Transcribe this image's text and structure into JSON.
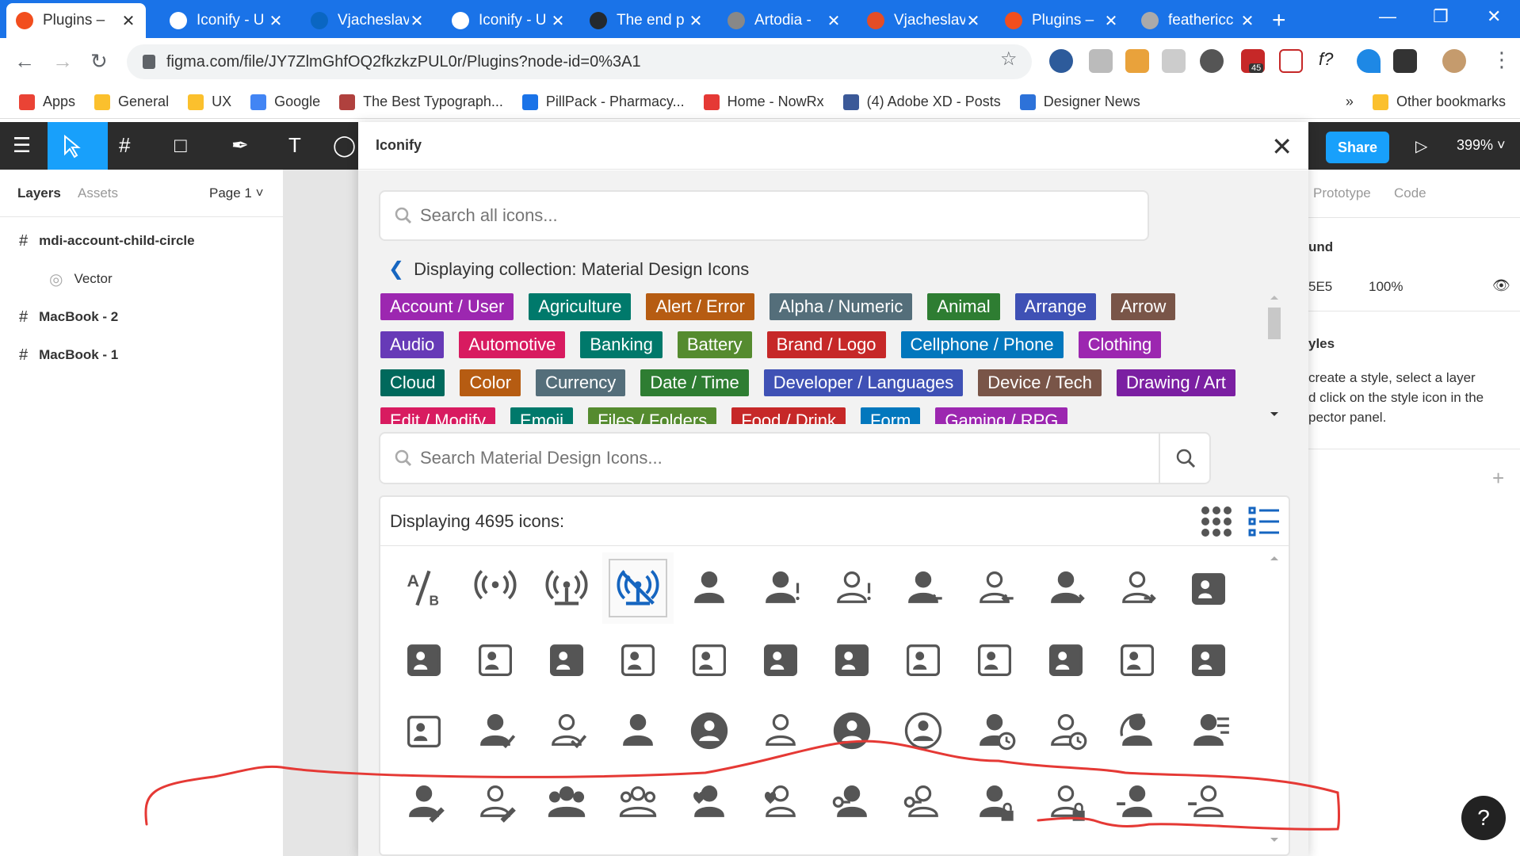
{
  "browser": {
    "tabs": [
      {
        "title": "Plugins – ",
        "active": true,
        "favicon_color": "#f24e1e"
      },
      {
        "title": "Iconify - U",
        "active": false,
        "favicon_color": "#ffffff"
      },
      {
        "title": "Vjacheslav",
        "active": false,
        "favicon_color": "#0a66c2"
      },
      {
        "title": "Iconify - U",
        "active": false,
        "favicon_color": "#ffffff"
      },
      {
        "title": "The end p",
        "active": false,
        "favicon_color": "#24292e"
      },
      {
        "title": "Artodia - ",
        "active": false,
        "favicon_color": "#888888"
      },
      {
        "title": "Vjacheslav",
        "active": false,
        "favicon_color": "#e44d26"
      },
      {
        "title": "Plugins – ",
        "active": false,
        "favicon_color": "#f24e1e"
      },
      {
        "title": "feathericc",
        "active": false,
        "favicon_color": "#aaaaaa"
      }
    ],
    "url": "figma.com/file/JY7ZlmGhfOQ2fkzkzPUL0r/Plugins?node-id=0%3A1",
    "bookmarks": [
      {
        "label": "Apps",
        "color": "#ea4335"
      },
      {
        "label": "General",
        "color": "#fbc02d"
      },
      {
        "label": "UX",
        "color": "#fbc02d"
      },
      {
        "label": "Google",
        "color": "#4285f4"
      },
      {
        "label": "The Best Typograph...",
        "color": "#b0413e"
      },
      {
        "label": "PillPack - Pharmacy...",
        "color": "#1a73e8"
      },
      {
        "label": "Home - NowRx",
        "color": "#e53935"
      },
      {
        "label": "(4) Adobe XD - Posts",
        "color": "#3b5998"
      },
      {
        "label": "Designer News",
        "color": "#2d72d9"
      }
    ],
    "bookmarks_more": "»",
    "other_bookmarks": "Other bookmarks",
    "ext_badge": "45"
  },
  "figma": {
    "share_label": "Share",
    "zoom": "399%",
    "left_tabs": {
      "layers": "Layers",
      "assets": "Assets",
      "page": "Page 1"
    },
    "layers": [
      {
        "name": "mdi-account-child-circle",
        "indent": false,
        "bold": true
      },
      {
        "name": "Vector",
        "indent": true,
        "bold": false
      },
      {
        "name": "MacBook - 2",
        "indent": false,
        "bold": true
      },
      {
        "name": "MacBook - 1",
        "indent": false,
        "bold": true
      }
    ],
    "right": {
      "tab_prototype": "Prototype",
      "tab_code": "Code",
      "bg_label": "und",
      "bg_hex": "5E5",
      "bg_opacity": "100%",
      "styles_label": "yles",
      "styles_hint": "create a style, select a layer\nd click on the style icon in the\npector panel."
    }
  },
  "plugin": {
    "title": "Iconify",
    "search_placeholder": "Search all icons...",
    "collection_text": "Displaying collection: Material Design Icons",
    "categories": [
      [
        {
          "label": "Account / User",
          "color": "#9c27b0"
        },
        {
          "label": "Agriculture",
          "color": "#00796b"
        },
        {
          "label": "Alert / Error",
          "color": "#b65c12"
        },
        {
          "label": "Alpha / Numeric",
          "color": "#546e7a"
        },
        {
          "label": "Animal",
          "color": "#2e7d32"
        },
        {
          "label": "Arrange",
          "color": "#3f51b5"
        },
        {
          "label": "Arrow",
          "color": "#795548"
        }
      ],
      [
        {
          "label": "Audio",
          "color": "#673ab7"
        },
        {
          "label": "Automotive",
          "color": "#d81b60"
        },
        {
          "label": "Banking",
          "color": "#00796b"
        },
        {
          "label": "Battery",
          "color": "#558b2f"
        },
        {
          "label": "Brand / Logo",
          "color": "#c62828"
        },
        {
          "label": "Cellphone / Phone",
          "color": "#0277bd"
        },
        {
          "label": "Clothing",
          "color": "#9c27b0"
        }
      ],
      [
        {
          "label": "Cloud",
          "color": "#00695c"
        },
        {
          "label": "Color",
          "color": "#b65c12"
        },
        {
          "label": "Currency",
          "color": "#546e7a"
        },
        {
          "label": "Date / Time",
          "color": "#2e7d32"
        },
        {
          "label": "Developer / Languages",
          "color": "#3f51b5"
        },
        {
          "label": "Device / Tech",
          "color": "#795548"
        },
        {
          "label": "Drawing / Art",
          "color": "#7b1fa2"
        }
      ],
      [
        {
          "label": "Edit / Modify",
          "color": "#d81b60"
        },
        {
          "label": "Emoji",
          "color": "#00796b"
        },
        {
          "label": "Files / Folders",
          "color": "#558b2f"
        },
        {
          "label": "Food / Drink",
          "color": "#c62828"
        },
        {
          "label": "Form",
          "color": "#0277bd"
        },
        {
          "label": "Gaming / RPG",
          "color": "#9c27b0"
        }
      ]
    ],
    "search2_placeholder": "Search Material Design Icons...",
    "count_text": "Displaying 4695 icons:",
    "icon_color": "#555555",
    "selected_color": "#1565c0",
    "icons": [
      "ab-testing-icon",
      "access-point-icon",
      "access-point-network-icon",
      "access-point-network-off-icon",
      "account-icon",
      "account-alert-icon",
      "account-alert-outline-icon",
      "account-arrow-left-icon",
      "account-arrow-left-outline-icon",
      "account-arrow-right-icon",
      "account-arrow-right-outline-icon",
      "account-badge-icon",
      "account-badge-alert-icon",
      "account-badge-alert-outline-icon",
      "account-badge-horizontal-icon",
      "account-badge-horizontal-outline-icon",
      "account-badge-outline-icon",
      "account-box-icon",
      "account-box-multiple-icon",
      "account-box-multiple-outline-icon",
      "account-box-outline-icon",
      "account-card-details-icon",
      "account-card-details-outline-icon",
      "account-cash-icon",
      "account-cash-outline-icon",
      "account-check-icon",
      "account-check-outline-icon",
      "account-child-icon",
      "account-child-circle-icon",
      "account-child-outline-icon",
      "account-circle-icon",
      "account-circle-outline-icon",
      "account-clock-icon",
      "account-clock-outline-icon",
      "account-convert-icon",
      "account-details-icon",
      "account-edit-icon",
      "account-edit-outline-icon",
      "account-group-icon",
      "account-group-outline-icon",
      "account-heart-icon",
      "account-heart-outline-icon",
      "account-key-icon",
      "account-key-outline-icon",
      "account-lock-icon",
      "account-lock-outline-icon",
      "account-minus-icon",
      "account-minus-outline-icon"
    ],
    "selected_index": 3
  }
}
